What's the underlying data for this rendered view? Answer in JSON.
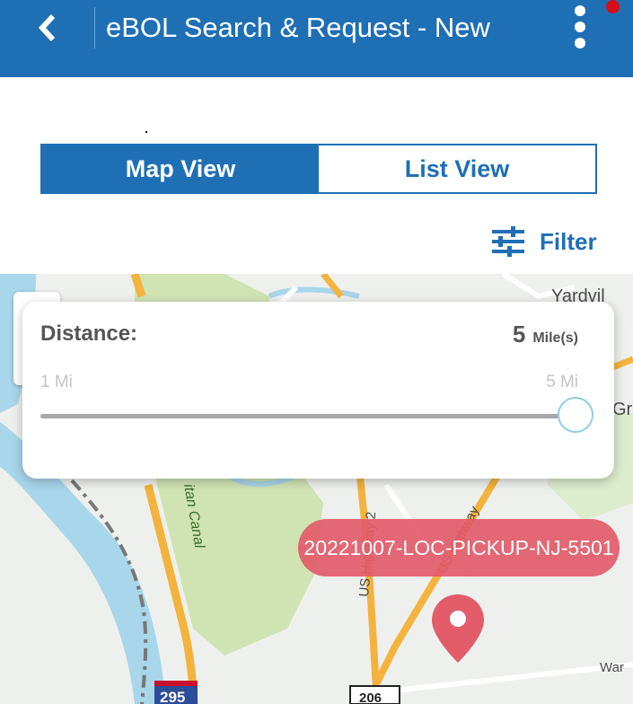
{
  "header": {
    "title": "eBOL Search & Request - New"
  },
  "view_toggle": {
    "map_label": "Map View",
    "list_label": "List View",
    "selected": "Map View"
  },
  "filter": {
    "label": "Filter"
  },
  "distance_card": {
    "label": "Distance:",
    "value": "5",
    "unit": "Mile(s)",
    "min_label": "1 Mi",
    "max_label": "5 Mi",
    "slider_min": 1,
    "slider_max": 5,
    "slider_value": 5
  },
  "map": {
    "labels": {
      "town": "Yardvil",
      "edge": "Gr",
      "canal": "itan Canal",
      "hwy_left": "US Highway 2",
      "hwy_right": "US Highway",
      "road": "War",
      "shield_295": "295",
      "shield_206": "206"
    },
    "marker_label": "20221007-LOC-PICKUP-NJ-5501"
  },
  "colors": {
    "brand": "#1f6fb5",
    "marker": "#e25c6a",
    "notification": "#d80d1a"
  },
  "icons": [
    "back-chevron-icon",
    "more-vert-icon",
    "filter-sliders-icon",
    "map-pin-icon"
  ]
}
